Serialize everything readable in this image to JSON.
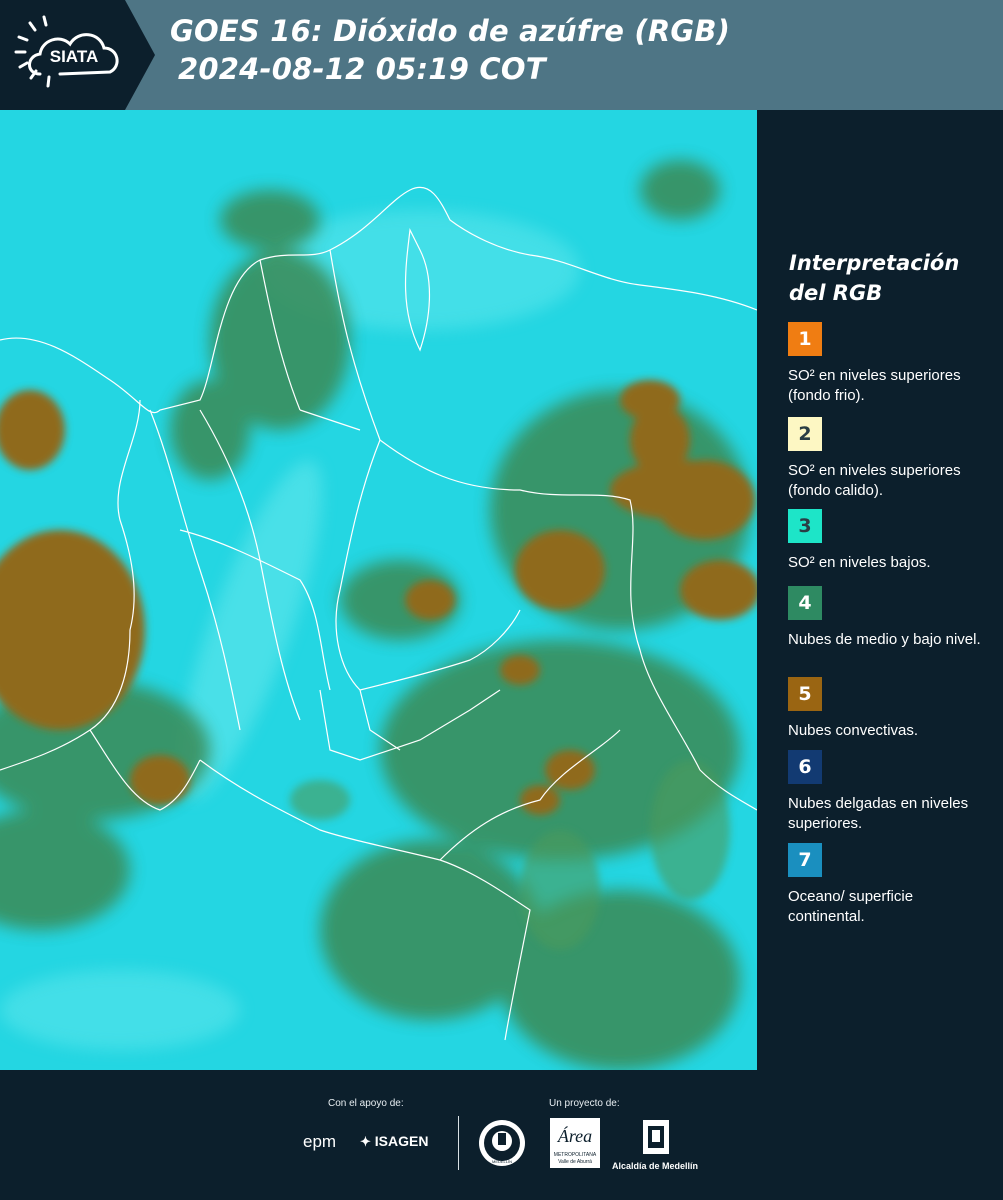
{
  "header": {
    "logo_text": "SIATA",
    "title_line1": "GOES 16: Dióxido de azúfre (RGB)",
    "title_line2": "2024-08-12 05:19 COT"
  },
  "legend": {
    "title_line1": "Interpretación",
    "title_line2": "del RGB",
    "items": [
      {
        "number": "1",
        "color": "#f07d12",
        "text": "SO² en niveles superiores (fondo frio)."
      },
      {
        "number": "2",
        "color": "#fdf7c3",
        "text": "SO² en niveles superiores (fondo calido)."
      },
      {
        "number": "3",
        "color": "#1de5c8",
        "text": "SO² en niveles bajos."
      },
      {
        "number": "4",
        "color": "#2e8a62",
        "text": "Nubes de medio y bajo nivel."
      },
      {
        "number": "5",
        "color": "#9a6512",
        "text": "Nubes convectivas."
      },
      {
        "number": "6",
        "color": "#123a72",
        "text": "Nubes delgadas en niveles superiores."
      },
      {
        "number": "7",
        "color": "#1a8fbf",
        "text": "Oceano/ superficie continental."
      }
    ]
  },
  "footer": {
    "support_label": "Con el apoyo de:",
    "project_label": "Un proyecto de:",
    "sponsor_epm": "epm",
    "sponsor_isagen": "ISAGEN",
    "seal_text": "MEDELLÍN",
    "area_text": "Área",
    "area_sub1": "METROPOLITANA",
    "area_sub2": "Valle de Aburrá",
    "alcaldia_text": "Alcaldía de Medellín"
  },
  "colors": {
    "header_bg": "#4e7585",
    "panel_bg": "#0c1f2c",
    "cyan_background": "#24d6e2",
    "convective": "#8f6a1e",
    "mid_low_clouds": "#3a8a55"
  }
}
